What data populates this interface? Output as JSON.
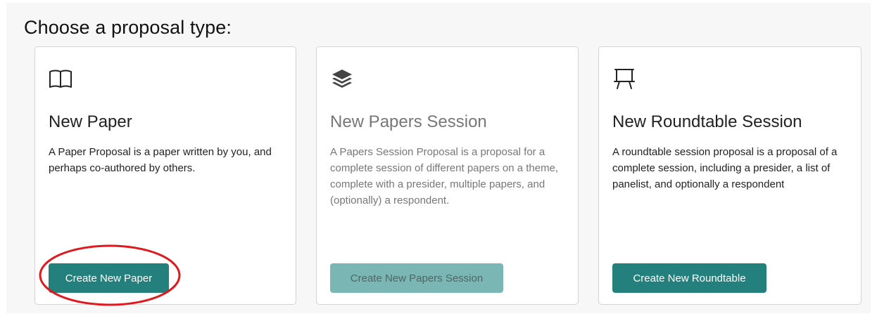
{
  "page": {
    "heading": "Choose a proposal type:"
  },
  "cards": [
    {
      "icon": "open-book-icon",
      "title": "New Paper",
      "description": "A Paper Proposal is a paper written by you, and perhaps co-authored by others.",
      "button_label": "Create New Paper"
    },
    {
      "icon": "layers-icon",
      "title": "New Papers Session",
      "description": "A Papers Session Proposal is a proposal for a complete session of different papers on a theme, complete with a presider, multiple papers, and (optionally) a respondent.",
      "button_label": "Create New Papers Session",
      "disabled": true
    },
    {
      "icon": "easel-icon",
      "title": "New Roundtable Session",
      "description": "A roundtable session proposal is a proposal of a complete session, including a presider, a list of panelist, and optionally a respondent",
      "button_label": "Create New Roundtable"
    }
  ],
  "annotation": {
    "shape": "ellipse",
    "target": "Create New Paper",
    "color": "#e0191f"
  },
  "colors": {
    "button": "#24807c",
    "button_disabled": "#7ab7b4",
    "panel_background": "#f7f7f8"
  }
}
